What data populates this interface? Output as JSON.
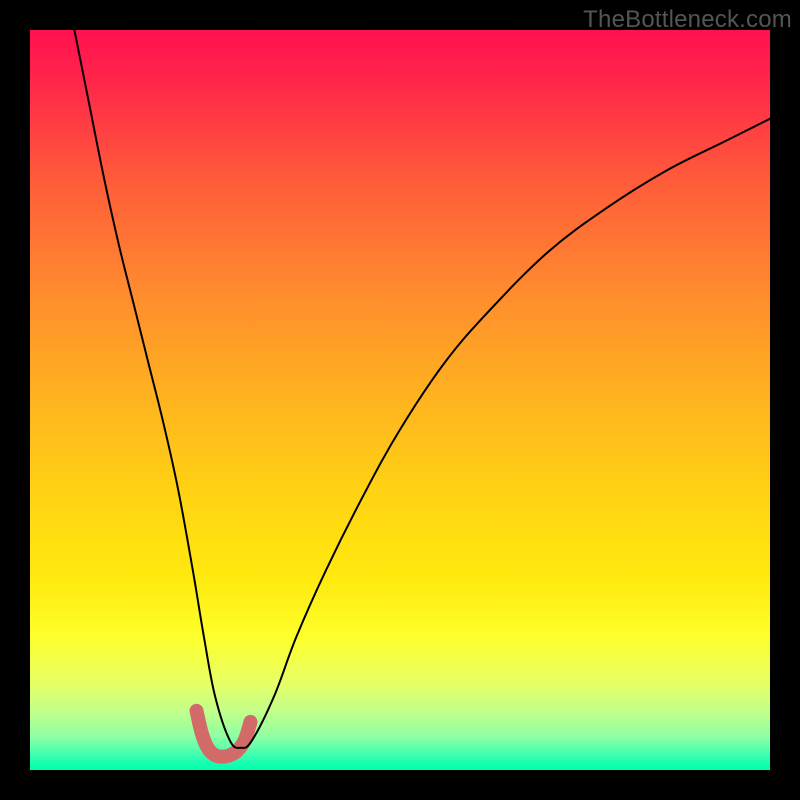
{
  "watermark": "TheBottleneck.com",
  "chart_data": {
    "type": "line",
    "title": "",
    "xlabel": "",
    "ylabel": "",
    "xlim": [
      0,
      100
    ],
    "ylim": [
      0,
      100
    ],
    "grid": false,
    "legend": false,
    "series": [
      {
        "name": "thin-curve",
        "stroke": "#000000",
        "stroke_width": 2,
        "x": [
          6,
          8,
          10,
          12,
          14,
          16,
          18,
          20,
          22,
          23.5,
          25,
          27,
          28.5,
          30,
          33,
          36,
          40,
          45,
          50,
          56,
          62,
          70,
          78,
          86,
          94,
          100
        ],
        "y": [
          100,
          90,
          80,
          71,
          63,
          55,
          47,
          38,
          27,
          18,
          10,
          4,
          3,
          4,
          10,
          18,
          27,
          37,
          46,
          55,
          62,
          70,
          76,
          81,
          85,
          88
        ]
      },
      {
        "name": "thick-marker-segment",
        "stroke": "#d26a6a",
        "stroke_width": 14,
        "x": [
          22.5,
          23.2,
          24.0,
          25.0,
          26.0,
          27.0,
          28.0,
          29.0,
          29.8
        ],
        "y": [
          8.0,
          5.0,
          3.0,
          2.0,
          1.8,
          2.0,
          2.6,
          4.0,
          6.5
        ]
      }
    ],
    "background_gradient_stops": [
      {
        "offset": 0.0,
        "color": "#ff1150"
      },
      {
        "offset": 0.08,
        "color": "#ff2a49"
      },
      {
        "offset": 0.2,
        "color": "#ff5a3a"
      },
      {
        "offset": 0.35,
        "color": "#ff8a2e"
      },
      {
        "offset": 0.5,
        "color": "#ffb41f"
      },
      {
        "offset": 0.63,
        "color": "#ffd313"
      },
      {
        "offset": 0.74,
        "color": "#ffe90e"
      },
      {
        "offset": 0.82,
        "color": "#fdff2b"
      },
      {
        "offset": 0.88,
        "color": "#e8ff63"
      },
      {
        "offset": 0.92,
        "color": "#c3ff8a"
      },
      {
        "offset": 0.955,
        "color": "#8dffa2"
      },
      {
        "offset": 0.975,
        "color": "#4effad"
      },
      {
        "offset": 0.99,
        "color": "#18ffb0"
      },
      {
        "offset": 1.0,
        "color": "#00ffad"
      }
    ]
  }
}
